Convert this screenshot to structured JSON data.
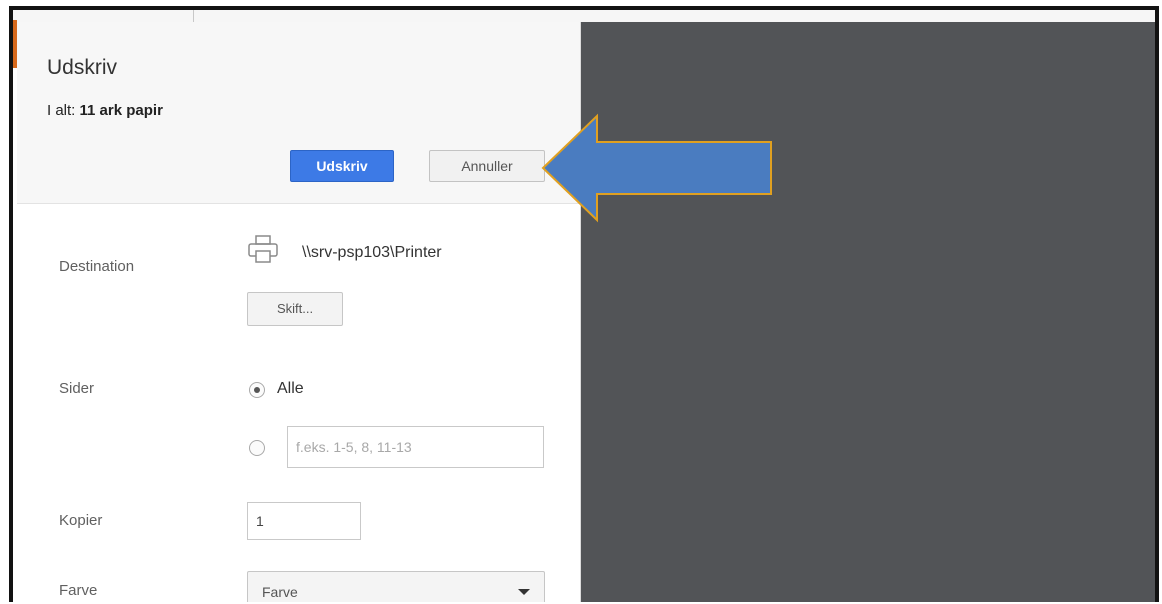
{
  "dialog": {
    "title": "Udskriv",
    "summary_prefix": "I alt:",
    "summary_count": "11 ark papir",
    "print_button": "Udskriv",
    "cancel_button": "Annuller"
  },
  "destination": {
    "label": "Destination",
    "printer_name": "\\\\srv-psp103\\Printer",
    "change_button": "Skift..."
  },
  "pages": {
    "label": "Sider",
    "option_all": "Alle",
    "option_all_selected": true,
    "range_placeholder": "f.eks. 1-5, 8, 11-13",
    "range_value": ""
  },
  "copies": {
    "label": "Kopier",
    "value": "1"
  },
  "color": {
    "label": "Farve",
    "selected": "Farve"
  },
  "colors": {
    "primary_button": "#3d7ae6",
    "preview_background": "#525457",
    "callout_arrow": "#4a7cc0"
  },
  "icons": {
    "printer": "printer-icon",
    "dropdown": "chevron-down-icon",
    "annotation": "left-arrow-icon"
  }
}
